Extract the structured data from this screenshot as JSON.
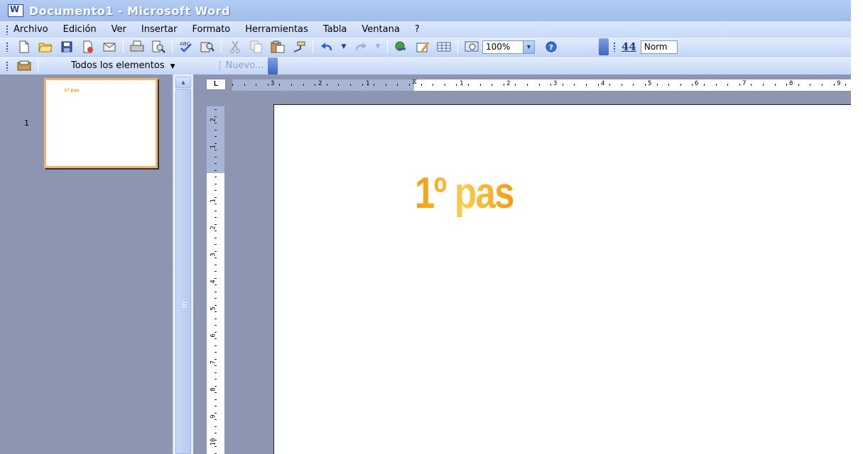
{
  "window": {
    "title": "Documento1 - Microsoft Word"
  },
  "menubar": {
    "items": [
      {
        "label": "Archivo"
      },
      {
        "label": "Edición"
      },
      {
        "label": "Ver"
      },
      {
        "label": "Insertar"
      },
      {
        "label": "Formato"
      },
      {
        "label": "Herramientas"
      },
      {
        "label": "Tabla"
      },
      {
        "label": "Ventana"
      },
      {
        "label": "?"
      }
    ]
  },
  "standard_toolbar": {
    "zoom_value": "100%",
    "style_value": "Norm",
    "style_icon_label": "44",
    "icons": [
      "new-document-icon",
      "open-folder-icon",
      "save-icon",
      "permission-icon",
      "mail-icon",
      "print-icon",
      "print-preview-icon",
      "spelling-icon",
      "research-icon",
      "cut-icon",
      "copy-icon",
      "paste-icon",
      "format-painter-icon",
      "undo-icon",
      "redo-icon",
      "hyperlink-icon",
      "tables-borders-icon",
      "insert-table-icon",
      "document-map-icon",
      "help-icon"
    ]
  },
  "clipboard_toolbar": {
    "all_items_label": "Todos los elementos",
    "new_label": "Nuevo..."
  },
  "thumbnails": {
    "page_number": "1",
    "thumb_text": "1º pas"
  },
  "ruler": {
    "horizontal_left_numbers": [
      "3",
      "2",
      "1"
    ],
    "horizontal_right_numbers": [
      "1",
      "2",
      "3",
      "4",
      "5",
      "6",
      "7",
      "8",
      "9"
    ],
    "vertical_top_numbers": [
      "2",
      "1"
    ],
    "vertical_numbers": [
      "1",
      "2",
      "3",
      "4",
      "5",
      "6",
      "7",
      "8",
      "9",
      "10"
    ],
    "corner_label": "L"
  },
  "document": {
    "wordart_text": "1º pas",
    "wordart_color_start": "#f59a12",
    "wordart_color_mid": "#fbcc4e"
  }
}
